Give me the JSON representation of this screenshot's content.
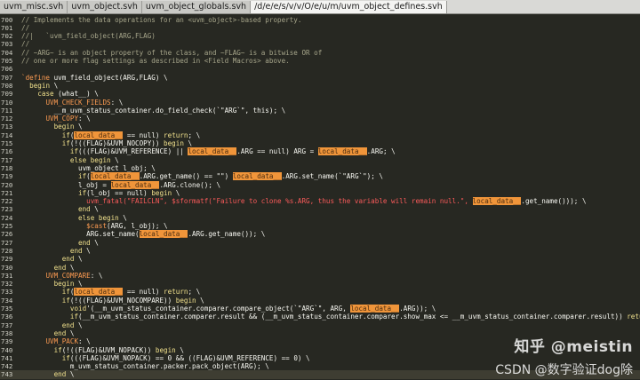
{
  "tabs": [
    {
      "label": "uvm_misc.svh",
      "active": false
    },
    {
      "label": "uvm_object.svh",
      "active": false
    },
    {
      "label": "uvm_object_globals.svh",
      "active": false
    },
    {
      "label": "/d/e/e/s/v/v/O/e/u/m/uvm_object_defines.svh",
      "active": true
    }
  ],
  "watermark": {
    "line1": "知乎 @meistin",
    "line2": "CSDN @数字验证dog除"
  },
  "editor": {
    "colors": {
      "background": "#272822",
      "comment": "#a6a58a",
      "keyword": "#f0e08c",
      "macro": "#fd9b52",
      "highlight": "#f0953a",
      "error": "#f95a5a"
    },
    "lines": [
      {
        "n": "700",
        "tokens": [
          [
            "cm",
            "// Implements the data operations for an <uvm_object>-based property."
          ]
        ]
      },
      {
        "n": "701",
        "tokens": [
          [
            "cm",
            "//"
          ]
        ]
      },
      {
        "n": "702",
        "tokens": [
          [
            "cm",
            "//|   `uvm_field_object(ARG,FLAG)"
          ]
        ]
      },
      {
        "n": "703",
        "tokens": [
          [
            "cm",
            "//"
          ]
        ]
      },
      {
        "n": "704",
        "tokens": [
          [
            "cm",
            "// ~ARG~ is an object property of the class, and ~FLAG~ is a bitwise OR of"
          ]
        ]
      },
      {
        "n": "705",
        "tokens": [
          [
            "cm",
            "// one or more flag settings as described in <Field Macros> above."
          ]
        ]
      },
      {
        "n": "706",
        "tokens": []
      },
      {
        "n": "707",
        "tokens": [
          [
            "mac",
            "`define"
          ],
          [
            "pl",
            " uvm_field_object(ARG,FLAG) \\"
          ]
        ]
      },
      {
        "n": "708",
        "tokens": [
          [
            "pl",
            "  "
          ],
          [
            "kw",
            "begin"
          ],
          [
            "pl",
            " \\"
          ]
        ]
      },
      {
        "n": "709",
        "tokens": [
          [
            "pl",
            "    "
          ],
          [
            "kw",
            "case"
          ],
          [
            "pl",
            " (what__) \\"
          ]
        ]
      },
      {
        "n": "710",
        "tokens": [
          [
            "pl",
            "      "
          ],
          [
            "mac",
            "UVM_CHECK_FIELDS"
          ],
          [
            "pl",
            ": \\"
          ]
        ]
      },
      {
        "n": "711",
        "tokens": [
          [
            "pl",
            "        __m_uvm_status_container.do_field_check(`\"ARG`\", this); \\"
          ]
        ]
      },
      {
        "n": "712",
        "tokens": [
          [
            "pl",
            "      "
          ],
          [
            "mac",
            "UVM_COPY"
          ],
          [
            "pl",
            ": \\"
          ]
        ]
      },
      {
        "n": "713",
        "tokens": [
          [
            "pl",
            "        "
          ],
          [
            "kw",
            "begin"
          ],
          [
            "pl",
            " \\"
          ]
        ]
      },
      {
        "n": "714",
        "tokens": [
          [
            "pl",
            "          "
          ],
          [
            "kw",
            "if"
          ],
          [
            "pl",
            "("
          ],
          [
            "hl",
            "local_data__"
          ],
          [
            "pl",
            " == null) "
          ],
          [
            "kw",
            "return"
          ],
          [
            "pl",
            "; \\"
          ]
        ]
      },
      {
        "n": "715",
        "tokens": [
          [
            "pl",
            "          "
          ],
          [
            "kw",
            "if"
          ],
          [
            "pl",
            "(!((FLAG)&UVM_NOCOPY)) "
          ],
          [
            "kw",
            "begin"
          ],
          [
            "pl",
            " \\"
          ]
        ]
      },
      {
        "n": "716",
        "tokens": [
          [
            "pl",
            "            "
          ],
          [
            "kw",
            "if"
          ],
          [
            "pl",
            "(((FLAG)&UVM_REFERENCE) || "
          ],
          [
            "hl",
            "local_data__"
          ],
          [
            "pl",
            ".ARG == null) ARG = "
          ],
          [
            "hl",
            "local_data__"
          ],
          [
            "pl",
            ".ARG; \\"
          ]
        ]
      },
      {
        "n": "717",
        "tokens": [
          [
            "pl",
            "            "
          ],
          [
            "kw",
            "else begin"
          ],
          [
            "pl",
            " \\"
          ]
        ]
      },
      {
        "n": "718",
        "tokens": [
          [
            "pl",
            "              uvm_object l_obj; \\"
          ]
        ]
      },
      {
        "n": "719",
        "tokens": [
          [
            "pl",
            "              "
          ],
          [
            "kw",
            "if"
          ],
          [
            "pl",
            "("
          ],
          [
            "hl",
            "local_data__"
          ],
          [
            "pl",
            ".ARG.get_name() == \"\") "
          ],
          [
            "hl",
            "local_data__"
          ],
          [
            "pl",
            ".ARG.set_name(`\"ARG`\"); \\"
          ]
        ]
      },
      {
        "n": "720",
        "tokens": [
          [
            "pl",
            "              l_obj = "
          ],
          [
            "hl",
            "local_data__"
          ],
          [
            "pl",
            ".ARG.clone(); \\"
          ]
        ]
      },
      {
        "n": "721",
        "tokens": [
          [
            "pl",
            "              "
          ],
          [
            "kw",
            "if"
          ],
          [
            "pl",
            "(l_obj == null) "
          ],
          [
            "kw",
            "begin"
          ],
          [
            "pl",
            " \\"
          ]
        ]
      },
      {
        "n": "722",
        "tokens": [
          [
            "pl",
            "                "
          ],
          [
            "err",
            "uvm_fatal(\"FAILCLN\", $sformatf(\"Failure to clone %s.ARG, thus the variable will remain null.\","
          ],
          [
            "pl",
            " "
          ],
          [
            "hl",
            "local_data__"
          ],
          [
            "pl",
            ".get_name())); \\"
          ]
        ]
      },
      {
        "n": "723",
        "tokens": [
          [
            "pl",
            "              "
          ],
          [
            "kw",
            "end"
          ],
          [
            "pl",
            " \\"
          ]
        ]
      },
      {
        "n": "724",
        "tokens": [
          [
            "pl",
            "              "
          ],
          [
            "kw",
            "else begin"
          ],
          [
            "pl",
            " \\"
          ]
        ]
      },
      {
        "n": "725",
        "tokens": [
          [
            "pl",
            "                "
          ],
          [
            "mac",
            "$cast"
          ],
          [
            "pl",
            "(ARG, l_obj); \\"
          ]
        ]
      },
      {
        "n": "726",
        "tokens": [
          [
            "pl",
            "                ARG.set_name("
          ],
          [
            "hl",
            "local_data__"
          ],
          [
            "pl",
            ".ARG.get_name()); \\"
          ]
        ]
      },
      {
        "n": "727",
        "tokens": [
          [
            "pl",
            "              "
          ],
          [
            "kw",
            "end"
          ],
          [
            "pl",
            " \\"
          ]
        ]
      },
      {
        "n": "728",
        "tokens": [
          [
            "pl",
            "            "
          ],
          [
            "kw",
            "end"
          ],
          [
            "pl",
            " \\"
          ]
        ]
      },
      {
        "n": "729",
        "tokens": [
          [
            "pl",
            "          "
          ],
          [
            "kw",
            "end"
          ],
          [
            "pl",
            " \\"
          ]
        ]
      },
      {
        "n": "730",
        "tokens": [
          [
            "pl",
            "        "
          ],
          [
            "kw",
            "end"
          ],
          [
            "pl",
            " \\"
          ]
        ]
      },
      {
        "n": "731",
        "tokens": [
          [
            "pl",
            "      "
          ],
          [
            "mac",
            "UVM_COMPARE"
          ],
          [
            "pl",
            ": \\"
          ]
        ]
      },
      {
        "n": "732",
        "tokens": [
          [
            "pl",
            "        "
          ],
          [
            "kw",
            "begin"
          ],
          [
            "pl",
            " \\"
          ]
        ]
      },
      {
        "n": "733",
        "tokens": [
          [
            "pl",
            "          "
          ],
          [
            "kw",
            "if"
          ],
          [
            "pl",
            "("
          ],
          [
            "hl",
            "local_data__"
          ],
          [
            "pl",
            " == null) "
          ],
          [
            "kw",
            "return"
          ],
          [
            "pl",
            "; \\"
          ]
        ]
      },
      {
        "n": "734",
        "tokens": [
          [
            "pl",
            "          "
          ],
          [
            "kw",
            "if"
          ],
          [
            "pl",
            "(!((FLAG)&UVM_NOCOMPARE)) "
          ],
          [
            "kw",
            "begin"
          ],
          [
            "pl",
            " \\"
          ]
        ]
      },
      {
        "n": "735",
        "tokens": [
          [
            "pl",
            "            "
          ],
          [
            "kw",
            "void"
          ],
          [
            "pl",
            "'(__m_uvm_status_container.comparer.compare_object(`\"ARG`\", ARG, "
          ],
          [
            "hl",
            "local_data__"
          ],
          [
            "pl",
            ".ARG)); \\"
          ]
        ]
      },
      {
        "n": "736",
        "tokens": [
          [
            "pl",
            "            "
          ],
          [
            "kw",
            "if"
          ],
          [
            "pl",
            "(__m_uvm_status_container.comparer.result && (__m_uvm_status_container.comparer.show_max <= __m_uvm_status_container.comparer.result)) "
          ],
          [
            "kw",
            "return"
          ],
          [
            "pl",
            "; \\"
          ]
        ]
      },
      {
        "n": "737",
        "tokens": [
          [
            "pl",
            "          "
          ],
          [
            "kw",
            "end"
          ],
          [
            "pl",
            " \\"
          ]
        ]
      },
      {
        "n": "738",
        "tokens": [
          [
            "pl",
            "        "
          ],
          [
            "kw",
            "end"
          ],
          [
            "pl",
            " \\"
          ]
        ]
      },
      {
        "n": "739",
        "tokens": [
          [
            "pl",
            "      "
          ],
          [
            "mac",
            "UVM_PACK"
          ],
          [
            "pl",
            ": \\"
          ]
        ]
      },
      {
        "n": "740",
        "tokens": [
          [
            "pl",
            "        "
          ],
          [
            "kw",
            "if"
          ],
          [
            "pl",
            "(!((FLAG)&UVM_NOPACK)) "
          ],
          [
            "kw",
            "begin"
          ],
          [
            "pl",
            " \\"
          ]
        ]
      },
      {
        "n": "741",
        "tokens": [
          [
            "pl",
            "          "
          ],
          [
            "kw",
            "if"
          ],
          [
            "pl",
            "(((FLAG)&UVM_NOPACK) == 0 && ((FLAG)&UVM_REFERENCE) == 0) \\"
          ]
        ]
      },
      {
        "n": "742",
        "tokens": [
          [
            "pl",
            "            m_uvm_status_container.packer.pack_object(ARG); \\"
          ]
        ]
      },
      {
        "n": "743",
        "tokens": [
          [
            "pl",
            "        "
          ],
          [
            "kw",
            "end"
          ],
          [
            "pl",
            " \\"
          ]
        ]
      }
    ]
  }
}
